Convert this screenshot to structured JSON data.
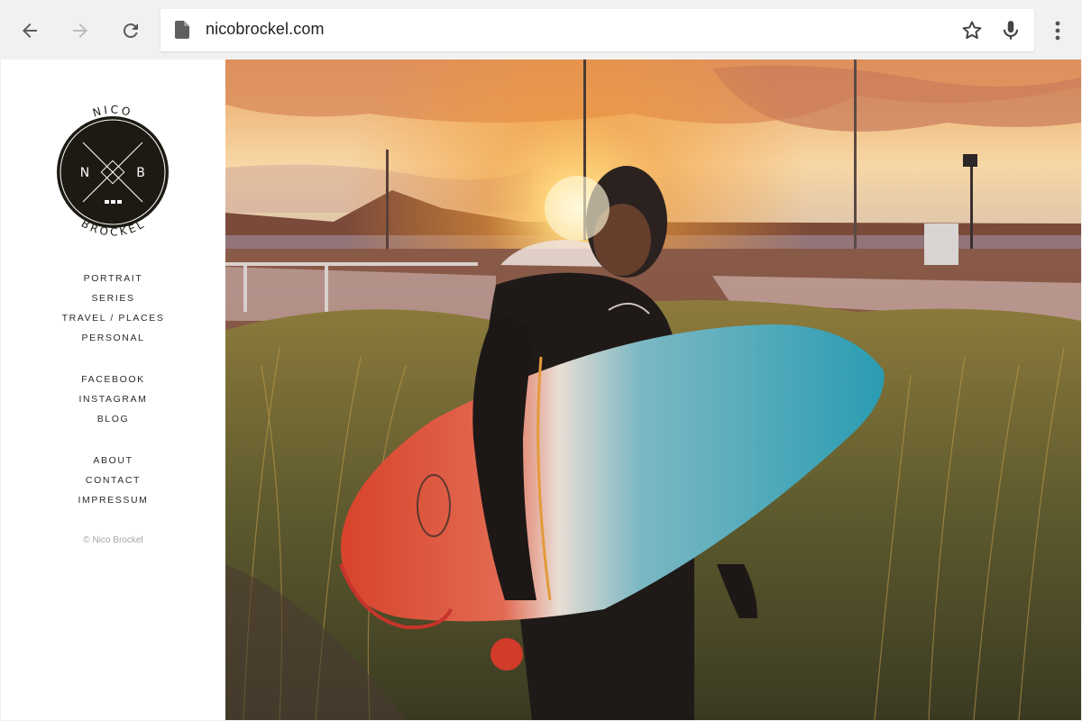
{
  "browser": {
    "url": "nicobrockel.com",
    "icons": {
      "back": "arrow-back-icon",
      "forward": "arrow-forward-icon",
      "reload": "reload-icon",
      "page": "page-icon",
      "bookmark": "star-icon",
      "voice": "mic-icon",
      "menu": "more-vert-icon"
    }
  },
  "site": {
    "logo": {
      "top_text": "NICO",
      "bottom_text": "BROCKEL",
      "left_letter": "N",
      "right_letter": "B"
    },
    "nav_primary": [
      {
        "label": "PORTRAIT"
      },
      {
        "label": "SERIES"
      },
      {
        "label": "TRAVEL / PLACES"
      },
      {
        "label": "PERSONAL"
      }
    ],
    "nav_social": [
      {
        "label": "FACEBOOK"
      },
      {
        "label": "INSTAGRAM"
      },
      {
        "label": "BLOG"
      }
    ],
    "nav_info": [
      {
        "label": "ABOUT"
      },
      {
        "label": "CONTACT"
      },
      {
        "label": "IMPRESSUM"
      }
    ],
    "copyright": "© Nico Brockel"
  },
  "hero": {
    "subject": "surfer-holding-surfboard-at-sunset"
  },
  "colors": {
    "chrome_bg": "#f1f1f1",
    "logo_fill": "#1c1a12",
    "board_red": "#d8432b",
    "board_teal": "#2a9cb2"
  }
}
